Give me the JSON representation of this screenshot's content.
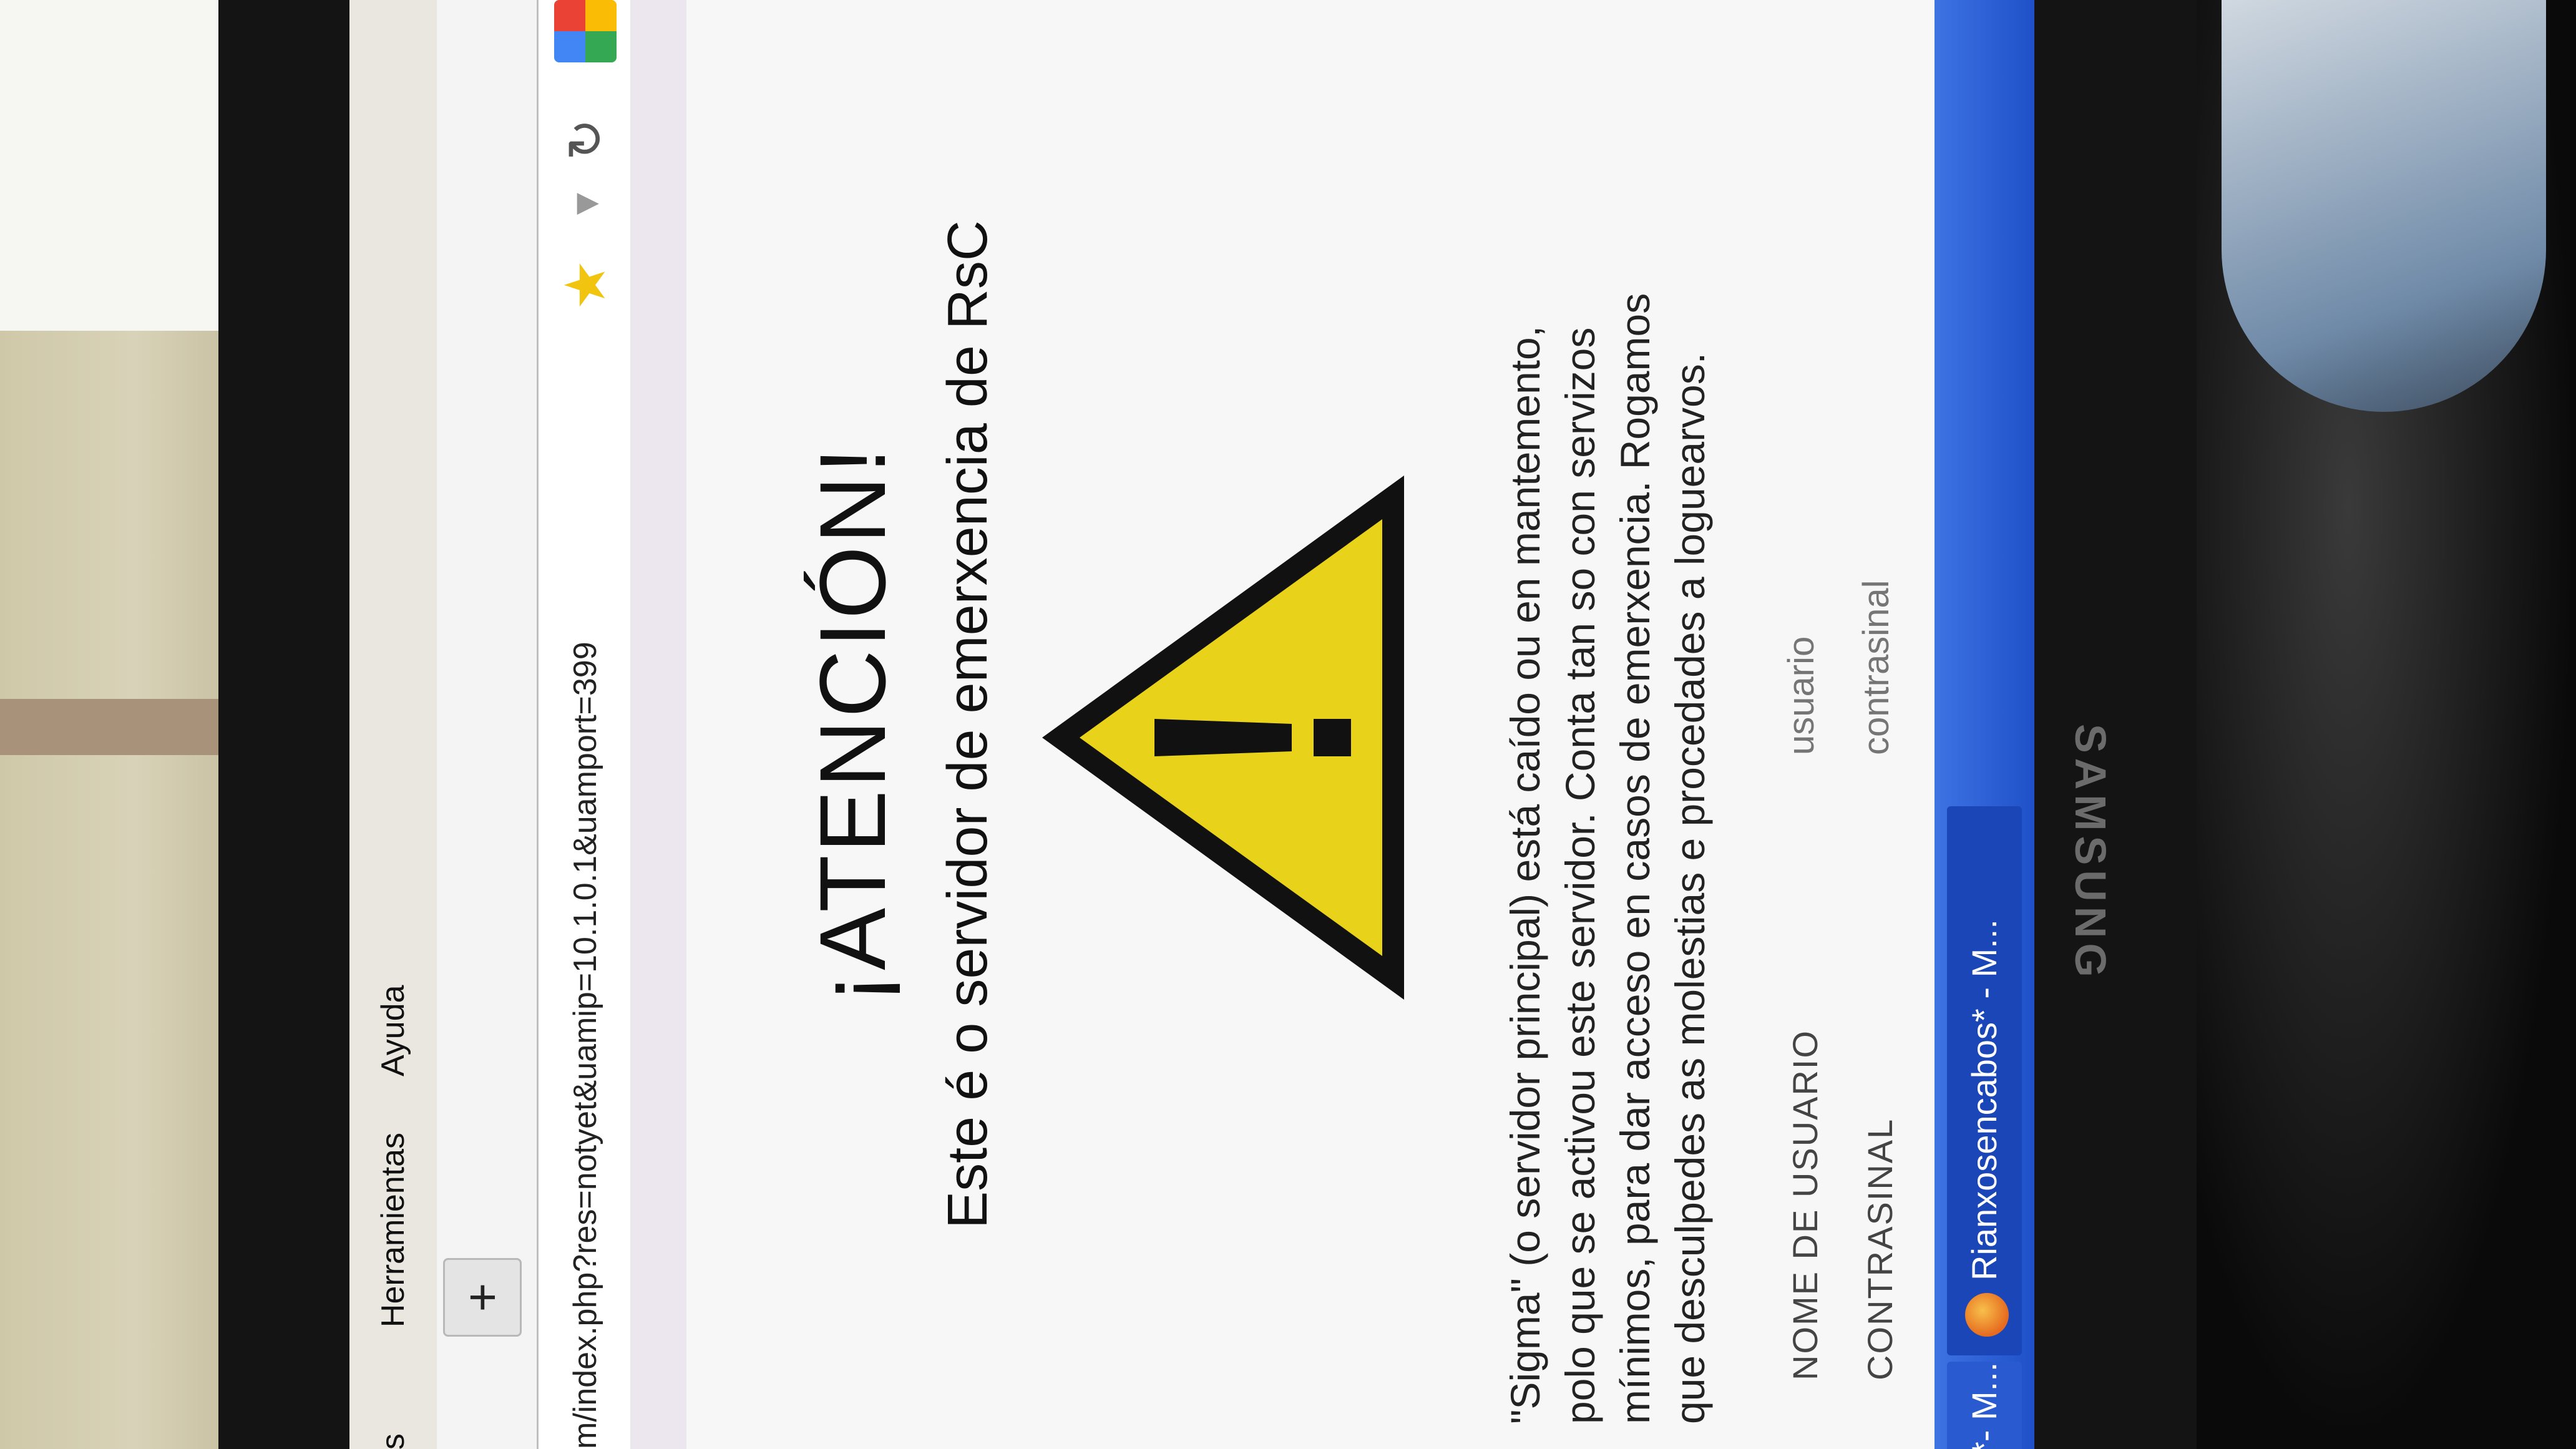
{
  "browser": {
    "menu": {
      "partial_item": "es",
      "tools": "Herramientas",
      "help": "Ayuda"
    },
    "new_tab_label": "+",
    "address_bar": {
      "url": "m/index.php?res=notyet&uamip=10.1.0.1&uamport=399"
    }
  },
  "page": {
    "title": "¡ATENCIÓN!",
    "subtitle": "Este é o servidor de emerxencia de RsC",
    "message_lines": [
      "\"Sigma\" (o servidor principal) está caído ou en mantemento,",
      "polo que se activou este servidor. Conta tan so con servizos",
      "mínimos, para dar acceso en casos de emerxencia. Rogamos",
      "que desculpedes as molestias e procedades a loguearvos."
    ],
    "login": {
      "username_label": "NOME DE USUARIO",
      "username_placeholder": "usuario",
      "password_label": "CONTRASINAL",
      "password_placeholder": "contrasinal"
    }
  },
  "taskbar": {
    "item_active": "Rianxosencabos* - M...",
    "item_other": "*- M..."
  },
  "monitor": {
    "brand": "SAMSUNG"
  },
  "colors": {
    "warning_yellow": "#e8d21a",
    "taskbar_blue": "#2f5fd8"
  }
}
